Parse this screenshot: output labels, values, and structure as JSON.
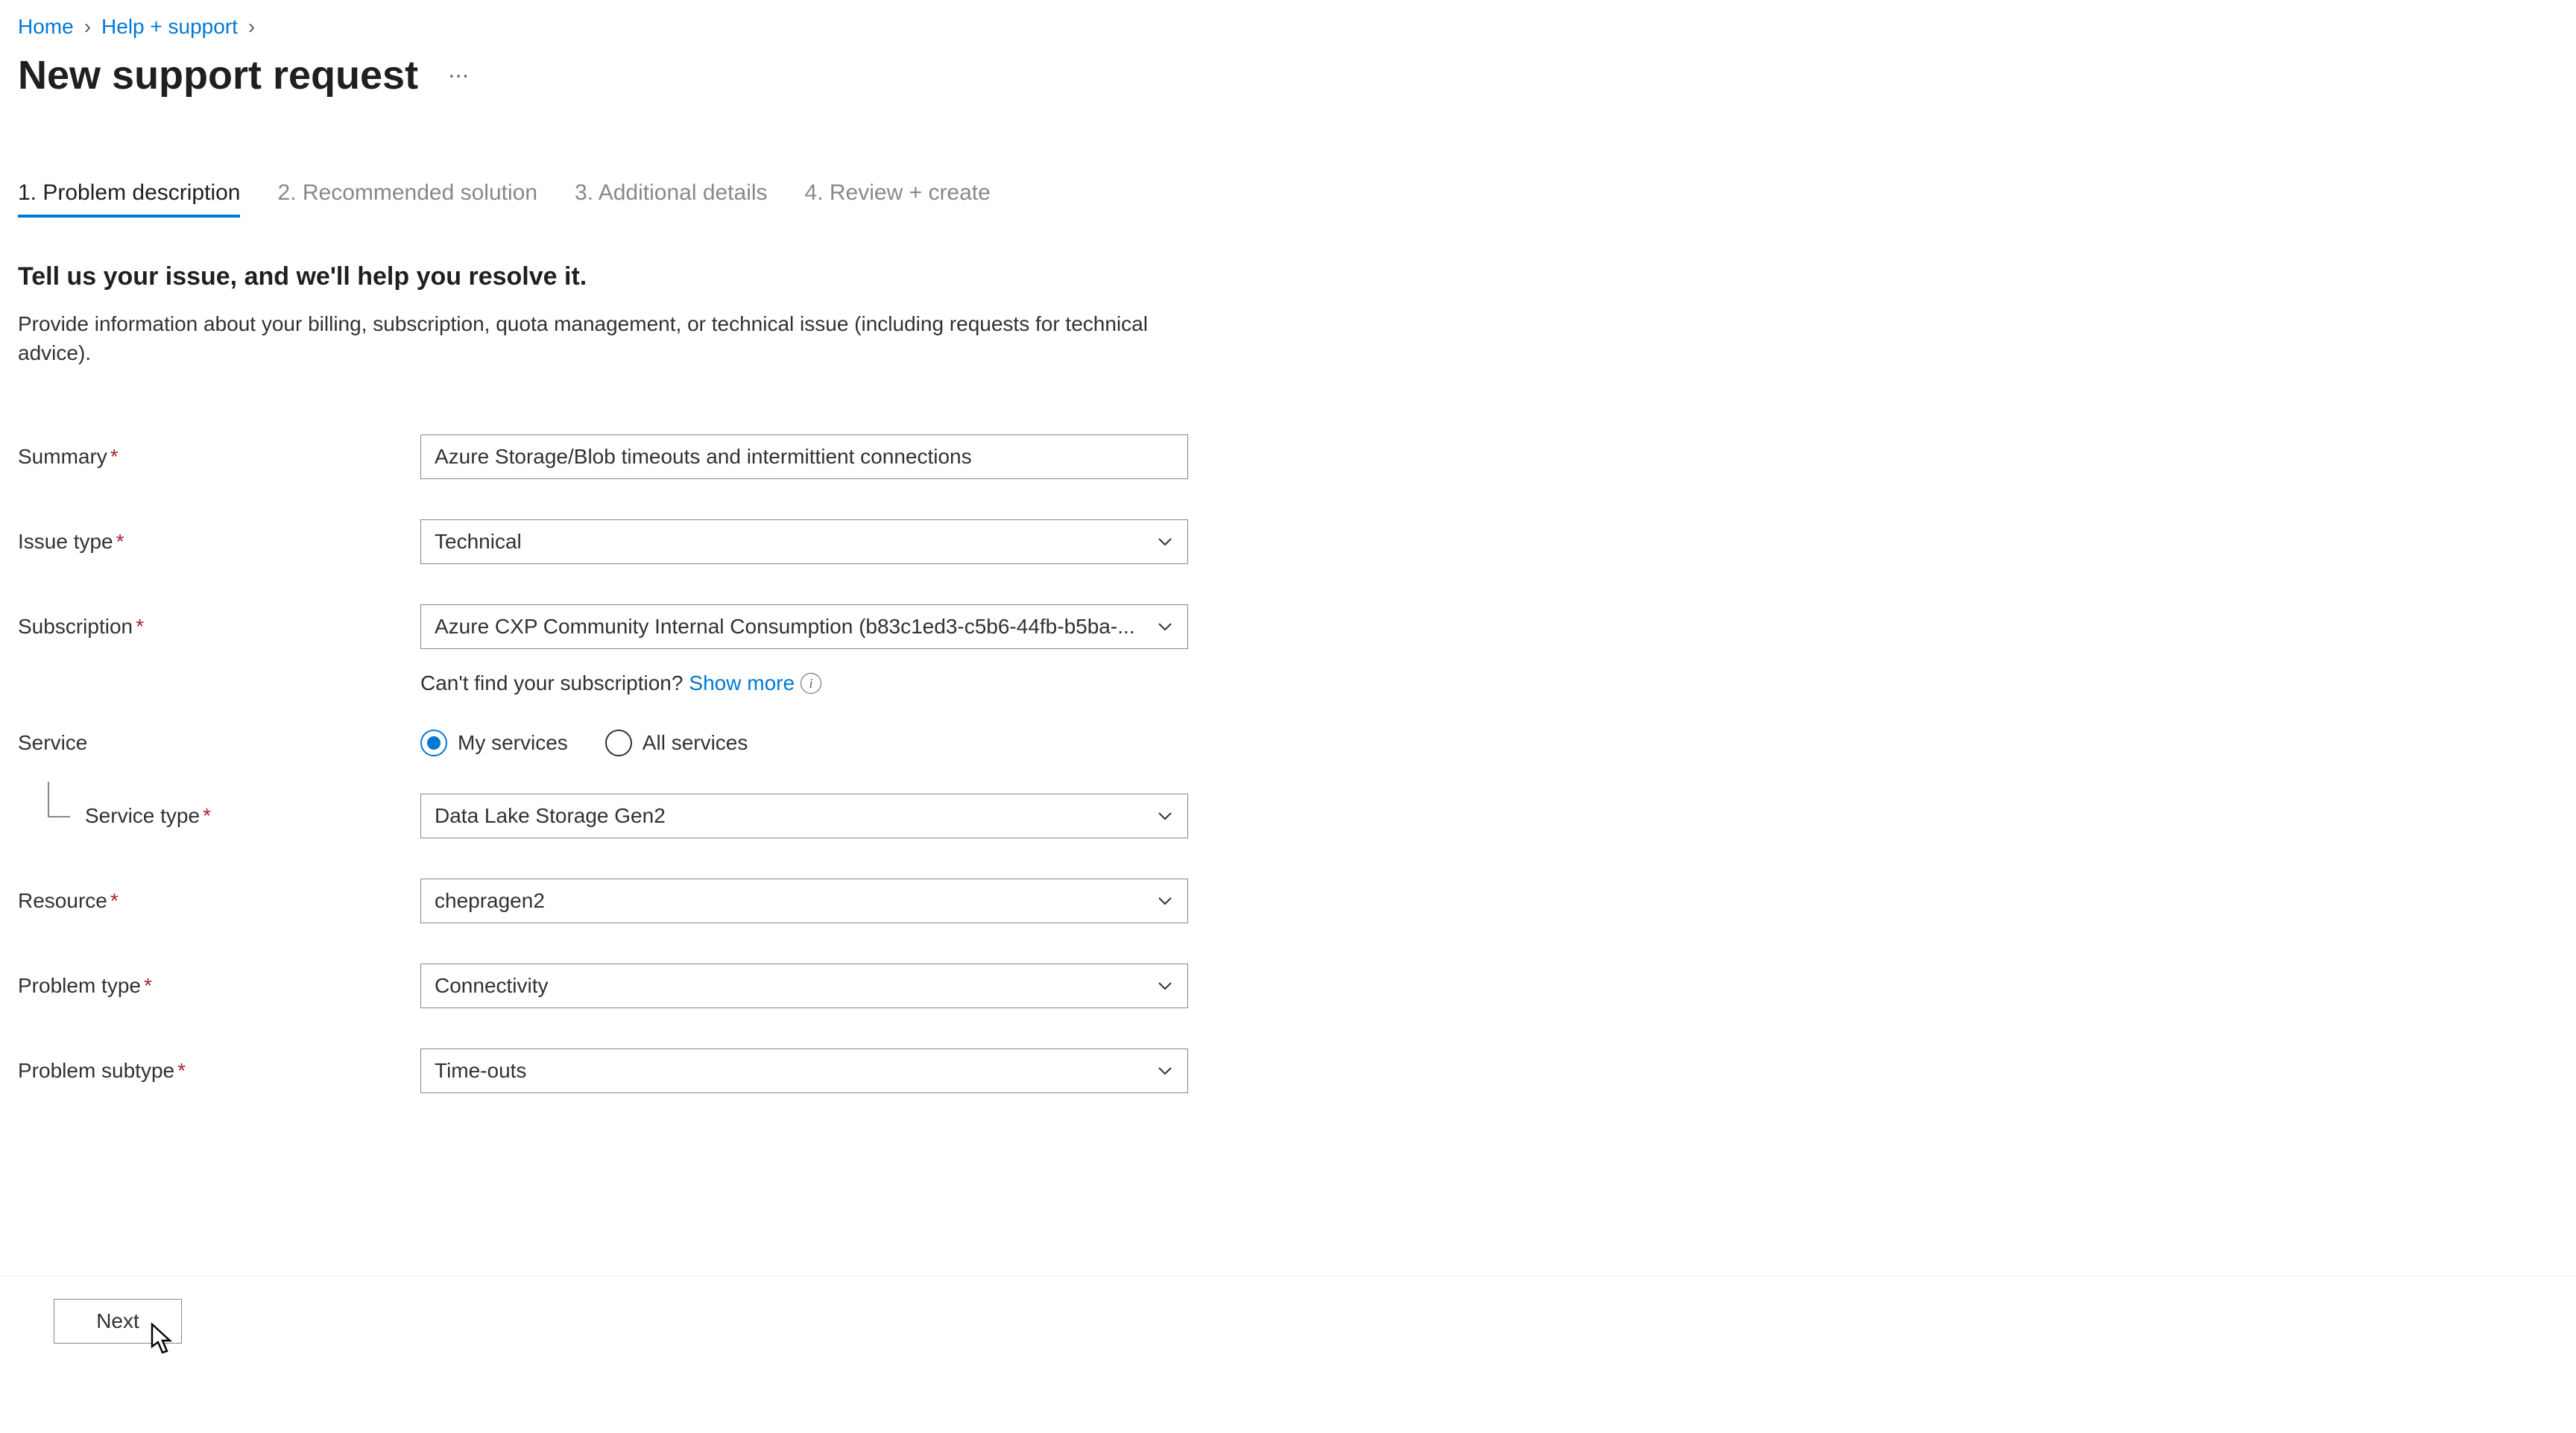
{
  "breadcrumb": {
    "home": "Home",
    "help": "Help + support"
  },
  "title": "New support request",
  "tabs": [
    "1. Problem description",
    "2. Recommended solution",
    "3. Additional details",
    "4. Review + create"
  ],
  "intro": {
    "heading": "Tell us your issue, and we'll help you resolve it.",
    "body": "Provide information about your billing, subscription, quota management, or technical issue (including requests for technical advice)."
  },
  "form": {
    "summary": {
      "label": "Summary",
      "value": "Azure Storage/Blob timeouts and intermittient connections"
    },
    "issue_type": {
      "label": "Issue type",
      "value": "Technical"
    },
    "subscription": {
      "label": "Subscription",
      "value": "Azure CXP Community Internal Consumption (b83c1ed3-c5b6-44fb-b5ba-..."
    },
    "sub_helper": {
      "text": "Can't find your subscription?",
      "link": "Show more"
    },
    "service": {
      "label": "Service",
      "options": {
        "my": "My services",
        "all": "All services"
      },
      "selected": "my"
    },
    "service_type": {
      "label": "Service type",
      "value": "Data Lake Storage Gen2"
    },
    "resource": {
      "label": "Resource",
      "value": "chepragen2"
    },
    "problem_type": {
      "label": "Problem type",
      "value": "Connectivity"
    },
    "problem_subtype": {
      "label": "Problem subtype",
      "value": "Time-outs"
    }
  },
  "footer": {
    "next": "Next"
  }
}
